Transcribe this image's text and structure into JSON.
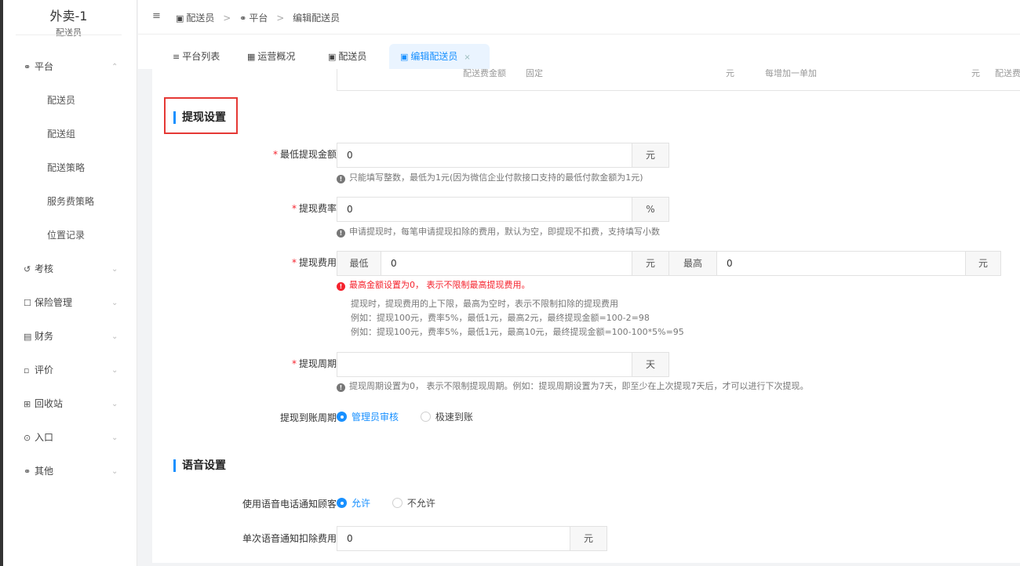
{
  "sidebar": {
    "title": "外卖-1",
    "subtitle": "配送员",
    "items": [
      {
        "label": "平台",
        "icon": "platform-icon",
        "chevron": "up"
      },
      {
        "label": "配送员"
      },
      {
        "label": "配送组"
      },
      {
        "label": "配送策略"
      },
      {
        "label": "服务费策略"
      },
      {
        "label": "位置记录"
      },
      {
        "label": "考核",
        "icon": "review-icon",
        "chevron": "down"
      },
      {
        "label": "保险管理",
        "icon": "insurance-icon",
        "chevron": "down"
      },
      {
        "label": "财务",
        "icon": "finance-icon",
        "chevron": "down"
      },
      {
        "label": "评价",
        "icon": "comment-icon",
        "chevron": "down"
      },
      {
        "label": "回收站",
        "icon": "trash-icon",
        "chevron": "down"
      },
      {
        "label": "入口",
        "icon": "entry-icon",
        "chevron": "down"
      },
      {
        "label": "其他",
        "icon": "other-icon",
        "chevron": "down"
      }
    ]
  },
  "breadcrumb": {
    "items": [
      "配送员",
      "平台",
      "编辑配送员"
    ]
  },
  "tabs": [
    {
      "label": "平台列表"
    },
    {
      "label": "运营概况"
    },
    {
      "label": "配送员"
    },
    {
      "label": "编辑配送员",
      "active": true
    }
  ],
  "prev_row": {
    "label": "配送费金额",
    "cells": [
      "固定",
      "元",
      "每增加一单加",
      "元",
      "配送费"
    ]
  },
  "withdraw": {
    "section_title": "提现设置",
    "min_amount": {
      "label": "最低提现金额",
      "value": "0",
      "unit": "元",
      "hint": "只能填写整数，最低为1元(因为微信企业付款接口支持的最低付款金额为1元)"
    },
    "rate": {
      "label": "提现费率",
      "value": "0",
      "unit": "%",
      "hint": "申请提现时，每笔申请提现扣除的费用，默认为空，即提现不扣费，支持填写小数"
    },
    "fee": {
      "label": "提现费用",
      "min_label": "最低",
      "min_value": "0",
      "min_unit": "元",
      "max_label": "最高",
      "max_value": "0",
      "max_unit": "元",
      "error": "最高金额设置为0，  表示不限制最高提现费用。",
      "notes": [
        "提现时，提现费用的上下限，最高为空时，表示不限制扣除的提现费用",
        "例如：提现100元，费率5%，最低1元，最高2元，最终提现金额=100-2=98",
        "例如：提现100元，费率5%，最低1元，最高10元，最终提现金额=100-100*5%=95"
      ]
    },
    "period": {
      "label": "提现周期",
      "value": "",
      "unit": "天",
      "hint": "提现周期设置为0，  表示不限制提现周期。例如：提现周期设置为7天，即至少在上次提现7天后，才可以进行下次提现。"
    },
    "arrival": {
      "label": "提现到账周期",
      "options": [
        "管理员审核",
        "极速到账"
      ],
      "selected": 0
    }
  },
  "voice": {
    "section_title": "语音设置",
    "notify": {
      "label": "使用语音电话通知顾客",
      "options": [
        "允许",
        "不允许"
      ],
      "selected": 0
    },
    "fee": {
      "label": "单次语音通知扣除费用",
      "value": "0",
      "unit": "元"
    }
  },
  "colors": {
    "accent": "#1890ff",
    "error": "#f5222d",
    "highlight": "#e53935"
  }
}
